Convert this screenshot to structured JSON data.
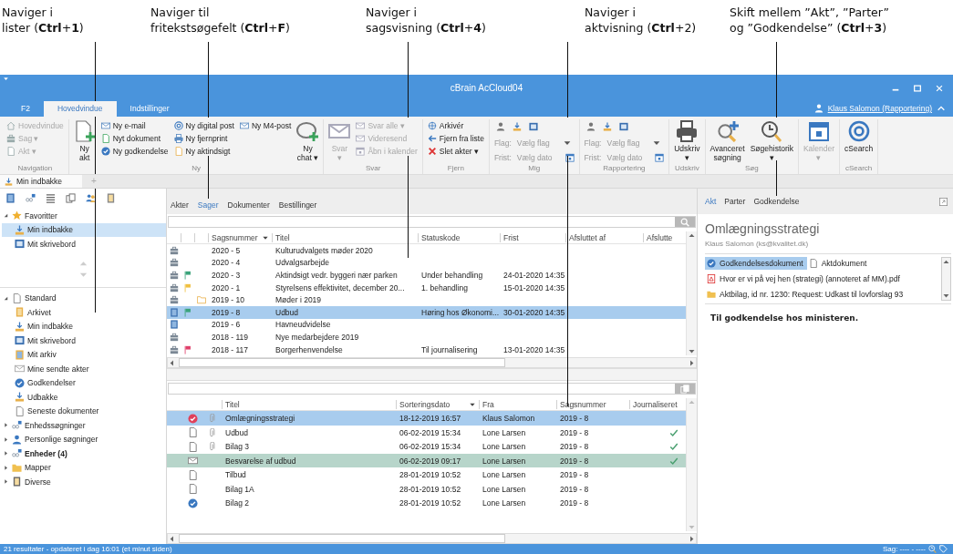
{
  "callouts": [
    {
      "lines": [
        "Naviger i",
        "lister (**Ctrl**+**1**)"
      ]
    },
    {
      "lines": [
        "Naviger til",
        "fritekstsøgefelt (**Ctrl**+**F**)"
      ]
    },
    {
      "lines": [
        "Naviger i",
        "sagsvisning (**Ctrl**+**4**)"
      ]
    },
    {
      "lines": [
        "Naviger i",
        "aktvisning (**Ctrl**+2)"
      ]
    },
    {
      "lines": [
        "Skift mellem ”Akt”, ”Parter”",
        "og ”Godkendelse” (**Ctrl**+**3**)"
      ]
    }
  ],
  "window": {
    "title": "cBrain AcCloud04",
    "user": "Klaus Salomon (Rapportering)"
  },
  "ribbon": {
    "tabs": [
      {
        "label": "F2",
        "selected": false
      },
      {
        "label": "Hovedvindue",
        "selected": true
      },
      {
        "label": "Indstillinger",
        "selected": false
      }
    ],
    "groups": [
      {
        "label": "Navigation",
        "columns": [
          {
            "kind": "stack",
            "items": [
              {
                "label": "Hovedvindue",
                "disabled": true
              },
              {
                "label": "Sag ▾",
                "disabled": true
              },
              {
                "label": "Akt ▾",
                "disabled": true
              }
            ]
          }
        ]
      },
      {
        "label": "Ny",
        "columns": [
          {
            "kind": "large",
            "label": "Ny akt",
            "disabled": false
          },
          {
            "kind": "stack",
            "items": [
              {
                "label": "Ny e-mail",
                "disabled": false
              },
              {
                "label": "Nyt dokument",
                "disabled": false
              },
              {
                "label": "Ny godkendelse",
                "disabled": false
              }
            ]
          },
          {
            "kind": "stack",
            "items": [
              {
                "label": "Ny digital post",
                "disabled": false
              },
              {
                "label": "Ny fjernprint",
                "disabled": false
              },
              {
                "label": "Ny aktindsigt",
                "disabled": false
              }
            ]
          },
          {
            "kind": "stack",
            "items": [
              {
                "label": "Ny M4-post",
                "disabled": false
              }
            ]
          },
          {
            "kind": "large",
            "label": "Ny chat ▾",
            "disabled": false
          }
        ]
      },
      {
        "label": "Svar",
        "columns": [
          {
            "kind": "large",
            "label": "Svar ▾",
            "disabled": true
          },
          {
            "kind": "stack",
            "items": [
              {
                "label": "Svar alle ▾",
                "disabled": true
              },
              {
                "label": "Videresend",
                "disabled": true
              },
              {
                "label": "Åbn i kalender",
                "disabled": true
              }
            ]
          }
        ]
      },
      {
        "label": "Fjern",
        "columns": [
          {
            "kind": "stack",
            "items": [
              {
                "label": "Arkivér",
                "disabled": false
              },
              {
                "label": "Fjern fra liste",
                "disabled": false
              },
              {
                "label": "Slet akter ▾",
                "disabled": false
              }
            ]
          }
        ]
      },
      {
        "label": "Mig",
        "columns": [
          {
            "kind": "fields",
            "fields": [
              {
                "kind": "dropdown",
                "label": "Flag:",
                "value": "Vælg flag"
              },
              {
                "kind": "date",
                "label": "Frist:",
                "value": "Vælg dato"
              }
            ]
          }
        ]
      },
      {
        "label": "Rapportering",
        "columns": [
          {
            "kind": "fields",
            "fields": [
              {
                "kind": "dropdown",
                "label": "Flag:",
                "value": "Vælg flag"
              },
              {
                "kind": "date",
                "label": "Frist:",
                "value": "Vælg dato"
              }
            ]
          }
        ]
      },
      {
        "label": "Udskriv",
        "columns": [
          {
            "kind": "large",
            "label": "Udskriv ▾",
            "disabled": false
          }
        ]
      },
      {
        "label": "Søg",
        "columns": [
          {
            "kind": "large",
            "label": "Avanceret søgning",
            "disabled": false
          },
          {
            "kind": "large",
            "label": "Søgehistorik ▾",
            "disabled": false
          }
        ]
      },
      {
        "columns": [
          {
            "kind": "large",
            "label": "Kalender ▾",
            "disabled": true
          }
        ]
      },
      {
        "label": "cSearch",
        "columns": [
          {
            "kind": "large",
            "label": "cSearch",
            "disabled": false
          }
        ]
      }
    ]
  },
  "doc_tabs": {
    "tabs": [
      {
        "label": "Min indbakke",
        "selected": true
      }
    ],
    "add": "+"
  },
  "sidebar": {
    "favorites": [
      {
        "label": "Favoritter",
        "expanded": true,
        "unread": false,
        "children": [
          {
            "label": "Min indbakke",
            "selected": true
          },
          {
            "label": "Mit skrivebord",
            "selected": false
          }
        ]
      }
    ],
    "tree": [
      {
        "label": "Standard",
        "expanded": true,
        "unread": false,
        "children": [
          {
            "label": "Arkivet",
            "selected": false
          },
          {
            "label": "Min indbakke",
            "selected": false
          },
          {
            "label": "Mit skrivebord",
            "selected": false
          },
          {
            "label": "Mit arkiv",
            "selected": false
          },
          {
            "label": "Mine sendte akter",
            "selected": false
          },
          {
            "label": "Godkendelser",
            "selected": false
          },
          {
            "label": "Udbakke",
            "selected": false
          },
          {
            "label": "Seneste dokumenter",
            "selected": false
          }
        ]
      },
      {
        "label": "Enhedssøgninger",
        "expanded": false,
        "unread": false
      },
      {
        "label": "Personlige søgninger",
        "expanded": false,
        "unread": false
      },
      {
        "label": "Enheder (4)",
        "expanded": false,
        "unread": true
      },
      {
        "label": "Mapper",
        "expanded": false,
        "unread": false
      },
      {
        "label": "Diverse",
        "expanded": false,
        "unread": false
      }
    ]
  },
  "cases": {
    "tabs": [
      {
        "label": "Akter",
        "selected": false
      },
      {
        "label": "Sager",
        "selected": true
      },
      {
        "label": "Dokumenter",
        "selected": false
      },
      {
        "label": "Bestillinger",
        "selected": false
      }
    ],
    "columns": [
      {
        "label": "Sagsnummer",
        "sorted": true
      },
      {
        "label": "Titel",
        "sorted": false
      },
      {
        "label": "Statuskode",
        "sorted": false
      },
      {
        "label": "Frist",
        "sorted": false
      },
      {
        "label": "Afsluttet af",
        "sorted": false
      },
      {
        "label": "Afslutte",
        "sorted": false
      }
    ],
    "rows": [
      {
        "kind": "case",
        "folder": false,
        "number": "2020 - 5",
        "title": "Kulturudvalgets møder 2020",
        "selected": false
      },
      {
        "kind": "case",
        "folder": false,
        "number": "2020 - 4",
        "title": "Udvalgsarbejde",
        "selected": false
      },
      {
        "kind": "case",
        "folder": false,
        "color": "#3aa37a",
        "number": "2020 - 3",
        "title": "Aktindsigt vedr. byggeri nær parken",
        "status": "Under behandling",
        "deadline": "24-01-2020 14:35",
        "selected": false
      },
      {
        "kind": "case",
        "folder": false,
        "color": "#f0c040",
        "number": "2020 - 1",
        "title": "Styrelsens effektivitet, december 20...",
        "status": "1. behandling",
        "deadline": "15-01-2020 14:35",
        "selected": false
      },
      {
        "kind": "case",
        "folder": true,
        "number": "2019 - 10",
        "title": "Møder i 2019",
        "selected": false
      },
      {
        "kind": "document",
        "folder": false,
        "color": "#3aa37a",
        "number": "2019 - 8",
        "title": "Udbud",
        "status": "Høring hos Økonomi...",
        "deadline": "30-01-2020 14:35",
        "selected": true
      },
      {
        "kind": "document",
        "folder": false,
        "number": "2019 - 6",
        "title": "Havneudvidelse",
        "selected": false
      },
      {
        "kind": "case",
        "folder": false,
        "number": "2018 - 119",
        "title": "Nye medarbejdere 2019",
        "selected": false
      },
      {
        "kind": "case",
        "folder": false,
        "color": "#e0406a",
        "number": "2018 - 117",
        "title": "Borgerhenvendelse",
        "status": "Til journalisering",
        "deadline": "13-01-2020 14:35",
        "selected": false
      }
    ]
  },
  "documents": {
    "columns": [
      {
        "label": "Titel",
        "sorted": false
      },
      {
        "label": "Sorteringsdato",
        "sorted": true
      },
      {
        "label": "Fra",
        "sorted": false
      },
      {
        "label": "Sagsnummer",
        "sorted": false
      },
      {
        "label": "Journaliseret",
        "sorted": false
      }
    ],
    "rows": [
      {
        "kind": "pending",
        "attachment": true,
        "title": "Omlægningsstrategi",
        "date": "18-12-2019 16:57",
        "from": "Klaus Salomon",
        "case": "2019 - 8",
        "journalized": false,
        "selected": true,
        "marked": false
      },
      {
        "kind": "document",
        "attachment": true,
        "title": "Udbud",
        "date": "06-02-2019 15:34",
        "from": "Lone Larsen",
        "case": "2019 - 8",
        "journalized": true,
        "selected": false,
        "marked": false
      },
      {
        "kind": "document",
        "attachment": true,
        "title": "Bilag 3",
        "date": "06-02-2019 15:34",
        "from": "Lone Larsen",
        "case": "2019 - 8",
        "journalized": true,
        "selected": false,
        "marked": false
      },
      {
        "kind": "email",
        "attachment": false,
        "title": "Besvarelse af udbud",
        "date": "06-02-2019 09:17",
        "from": "Lone Larsen",
        "case": "2019 - 8",
        "journalized": true,
        "selected": false,
        "marked": true
      },
      {
        "kind": "document",
        "attachment": false,
        "title": "Tilbud",
        "date": "28-01-2019 10:52",
        "from": "Lone Larsen",
        "case": "2019 - 8",
        "journalized": false,
        "selected": false,
        "marked": false
      },
      {
        "kind": "document",
        "attachment": false,
        "title": "Bilag 1A",
        "date": "28-01-2019 10:52",
        "from": "Lone Larsen",
        "case": "2019 - 8",
        "journalized": false,
        "selected": false,
        "marked": false
      },
      {
        "kind": "approved",
        "attachment": false,
        "title": "Bilag 2",
        "date": "28-01-2019 10:52",
        "from": "Lone Larsen",
        "case": "2019 - 8",
        "journalized": false,
        "selected": false,
        "marked": false
      }
    ]
  },
  "detail": {
    "tabs": [
      {
        "label": "Akt",
        "selected": true
      },
      {
        "label": "Parter",
        "selected": false
      },
      {
        "label": "Godkendelse",
        "selected": false
      }
    ],
    "title": "Omlægningsstrategi",
    "author": "Klaus Salomon (ks@kvalitet.dk)",
    "files": [
      {
        "kind": "approval",
        "label": "Godkendelsesdokument",
        "selected": true
      },
      {
        "kind": "document",
        "label": "Aktdokument",
        "selected": false
      },
      {
        "kind": "pdf",
        "label": "Hvor er vi på vej hen (strategi) (annoteret af MM).pdf",
        "selected": false
      },
      {
        "kind": "folder",
        "label": "Aktbilag, id nr. 1230: Request: Udkast til lovforslag 93",
        "selected": false
      }
    ],
    "note": "Til godkendelse hos ministeren."
  },
  "status_bar": {
    "text": "21 resultater - opdateret i dag 16:01 (et minut siden)",
    "case": "Sag: ---- - ----"
  }
}
